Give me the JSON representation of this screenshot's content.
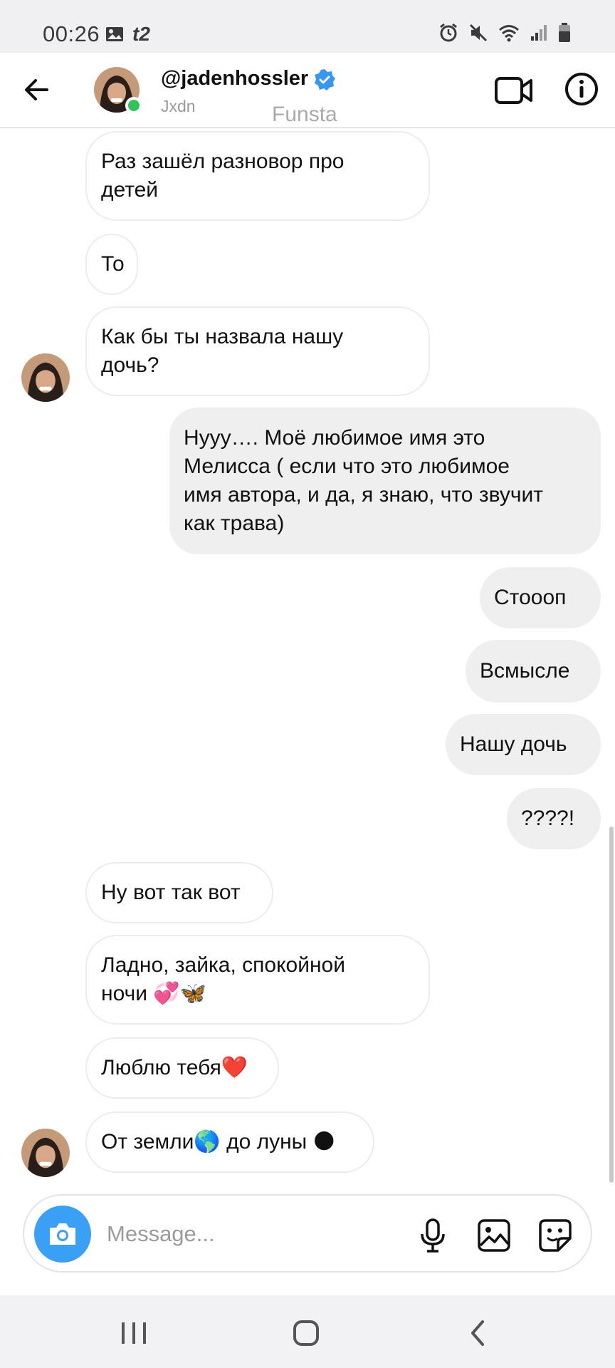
{
  "status_bar": {
    "time": "00:26",
    "carrier": "t2",
    "left_icons": [
      "image-icon",
      "carrier-icon"
    ],
    "right_icons": [
      "alarm-icon",
      "mute-icon",
      "wifi-icon",
      "signal-icon",
      "battery-icon"
    ]
  },
  "header": {
    "username": "@jadenhossler",
    "display_name": "Jxdn",
    "overlay_text": "Funsta",
    "online": true,
    "verified": true
  },
  "messages": [
    {
      "side": "in",
      "lines": [
        "Раз зашёл разновор про",
        "детей"
      ]
    },
    {
      "side": "in",
      "lines": [
        "То"
      ]
    },
    {
      "side": "in",
      "lines": [
        "Как бы ты назвала нашу",
        "дочь?"
      ],
      "avatar": true
    },
    {
      "side": "out",
      "lines": [
        "Нууу…. Моё любимое имя это",
        "Мелисса ( если что это любимое",
        "имя автора, и да, я знаю, что звучит",
        "как трава)"
      ]
    },
    {
      "side": "out",
      "lines": [
        "Стоооп"
      ]
    },
    {
      "side": "out",
      "lines": [
        "Всмысле"
      ]
    },
    {
      "side": "out",
      "lines": [
        "Нашу дочь"
      ]
    },
    {
      "side": "out",
      "lines": [
        "????!"
      ]
    },
    {
      "side": "in",
      "lines": [
        "Ну вот так вот"
      ]
    },
    {
      "side": "in",
      "lines": [
        "Ладно, зайка, спокойной",
        "ночи 💞🦋"
      ]
    },
    {
      "side": "in",
      "lines": [
        "Люблю тебя❤️"
      ]
    },
    {
      "side": "in",
      "lines": [
        "От земли🌎 до луны 🌑"
      ],
      "avatar": true
    }
  ],
  "composer": {
    "placeholder": "Message...",
    "value": ""
  },
  "colors": {
    "accent": "#3aa0f5",
    "online": "#2ec45a",
    "verified": "#3897f0",
    "outgoing_bubble": "#efefef"
  }
}
